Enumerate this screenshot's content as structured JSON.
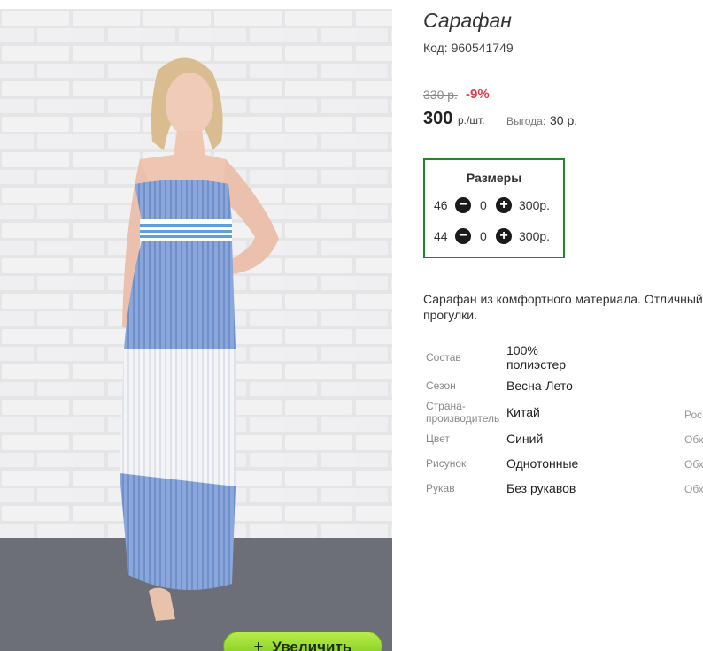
{
  "product": {
    "title": "Сарафан",
    "code": "Код: 960541749",
    "old_price": "330 р.",
    "discount": "-9%",
    "price": "300",
    "price_unit": "р./шт.",
    "benefit_label": "Выгода:",
    "benefit_value": "30 р.",
    "zoom_button": "Увеличить",
    "zoom_icon": "+"
  },
  "sizes": {
    "title": "Размеры",
    "rows": [
      {
        "size": "46",
        "qty": "0",
        "price": "300р.",
        "minus": "−",
        "plus": "+"
      },
      {
        "size": "44",
        "qty": "0",
        "price": "300р.",
        "minus": "−",
        "plus": "+"
      }
    ]
  },
  "description": "Сарафан из комфортного материала. Отличный прогулки.",
  "attributes": [
    {
      "label": "Состав",
      "value": "100% полиэстер"
    },
    {
      "label": "Сезон",
      "value": "Весна-Лето"
    },
    {
      "label": "Страна-производитель",
      "value": "Китай"
    },
    {
      "label": "Цвет",
      "value": "Синий"
    },
    {
      "label": "Рисунок",
      "value": "Однотонные"
    },
    {
      "label": "Рукав",
      "value": "Без рукавов"
    }
  ],
  "edge_text": [
    "Рос",
    "Обх",
    "Обх",
    "Обх"
  ],
  "colors": {
    "accent_green": "#1b8a2a",
    "discount_red": "#e63b4a",
    "dress_blue": "#7f9fd6"
  }
}
